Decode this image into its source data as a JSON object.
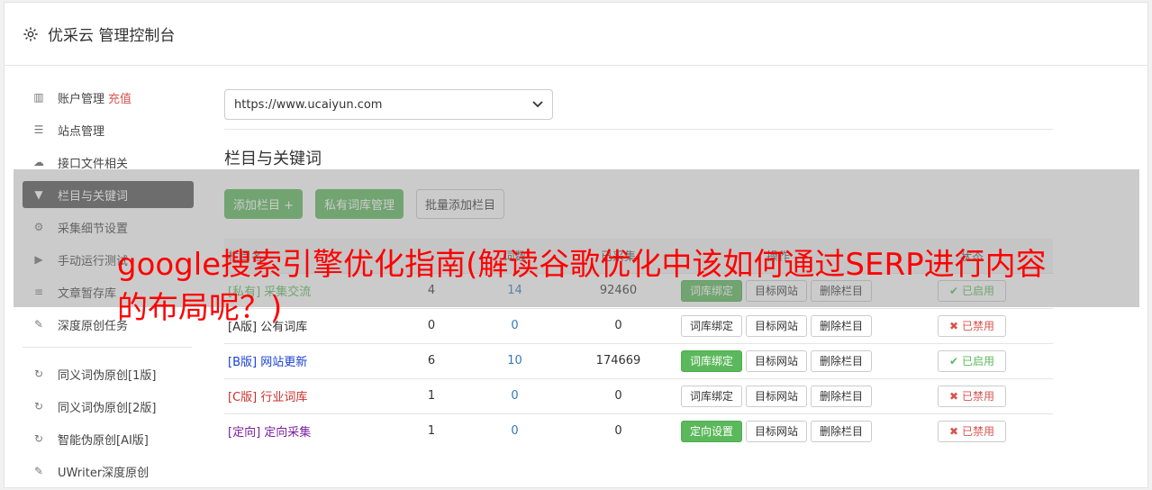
{
  "header": {
    "title": "优采云 管理控制台"
  },
  "sidebar": {
    "items": [
      {
        "label": "账户管理",
        "extra": "充值",
        "icon": "bar-chart-icon"
      },
      {
        "label": "站点管理",
        "icon": "server-icon"
      },
      {
        "label": "接口文件相关",
        "icon": "cloud-upload-icon"
      },
      {
        "label": "栏目与关键词",
        "icon": "filter-icon",
        "active": true
      },
      {
        "label": "采集细节设置",
        "icon": "gears-icon"
      },
      {
        "label": "手动运行测试",
        "icon": "play-circle-icon"
      },
      {
        "label": "文章暂存库",
        "icon": "database-icon"
      },
      {
        "label": "深度原创任务",
        "icon": "edit-icon"
      }
    ],
    "items2": [
      {
        "label": "同义词伪原创[1版]",
        "icon": "refresh-icon"
      },
      {
        "label": "同义词伪原创[2版]",
        "icon": "refresh-icon"
      },
      {
        "label": "智能伪原创[AI版]",
        "icon": "refresh-icon"
      },
      {
        "label": "UWriter深度原创",
        "icon": "edit-icon"
      }
    ]
  },
  "main": {
    "site_select": "https://www.ucaiyun.com",
    "section_title": "栏目与关键词",
    "buttons": {
      "add": "添加栏目 +",
      "private": "私有词库管理",
      "batch": "批量添加栏目"
    },
    "table": {
      "headers": [
        "栏目名",
        "词数",
        "已采集",
        "操作",
        "状态"
      ],
      "rows": [
        {
          "tag": "[私有]",
          "name": "采集交流",
          "a": "4",
          "b": "14",
          "c": "92460",
          "op1": "词库绑定",
          "op1_green": true,
          "op2": "目标网站",
          "op3": "删除栏目",
          "status": "已启用",
          "on": true,
          "color": "#5cb85c"
        },
        {
          "tag": "[A版]",
          "name": "公有词库",
          "a": "0",
          "b": "0",
          "c": "0",
          "op1": "词库绑定",
          "op1_green": false,
          "op2": "目标网站",
          "op3": "删除栏目",
          "status": "已禁用",
          "on": false,
          "color": "#333"
        },
        {
          "tag": "[B版]",
          "name": "网站更新",
          "a": "6",
          "b": "10",
          "c": "174669",
          "op1": "词库绑定",
          "op1_green": true,
          "op2": "目标网站",
          "op3": "删除栏目",
          "status": "已启用",
          "on": true,
          "color": "#1a3fd6"
        },
        {
          "tag": "[C版]",
          "name": "行业词库",
          "a": "1",
          "b": "0",
          "c": "0",
          "op1": "词库绑定",
          "op1_green": false,
          "op2": "目标网站",
          "op3": "删除栏目",
          "status": "已禁用",
          "on": false,
          "color": "#c9302c"
        },
        {
          "tag": "[定向]",
          "name": "定向采集",
          "a": "1",
          "b": "0",
          "c": "0",
          "op1": "定向设置",
          "op1_green": true,
          "op2": "目标网站",
          "op3": "删除栏目",
          "status": "已禁用",
          "on": false,
          "color": "#7b1fa2"
        }
      ]
    }
  },
  "overlay": {
    "title": "google搜索引擎优化指南(解读谷歌优化中该如何通过SERP进行内容的布局呢？)"
  }
}
